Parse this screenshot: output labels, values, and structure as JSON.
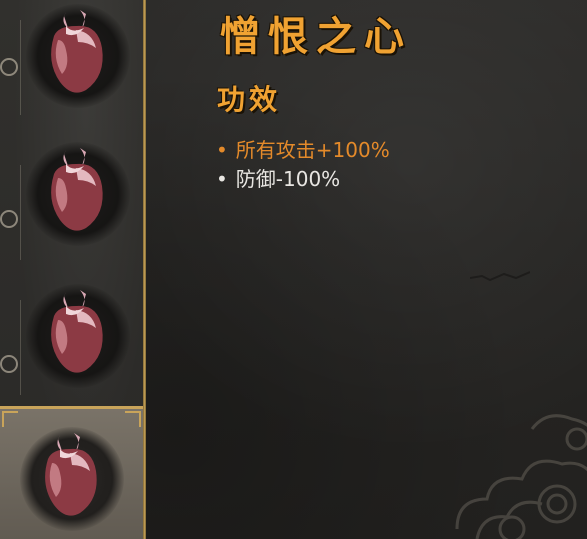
{
  "item": {
    "name": "憎恨之心",
    "section_heading": "功效",
    "effects": [
      {
        "bullet": "•",
        "text": "所有攻击+100%"
      },
      {
        "bullet": "•",
        "text": "防御-100%"
      }
    ]
  },
  "slots": [
    {
      "icon": "heart-icon",
      "selected": false
    },
    {
      "icon": "heart-icon",
      "selected": false
    },
    {
      "icon": "heart-icon",
      "selected": false
    },
    {
      "icon": "heart-icon",
      "selected": true
    }
  ],
  "colors": {
    "title": "#f0a232",
    "positive_effect": "#e48a2a",
    "negative_effect": "#e8e6e2",
    "frame_gold": "#c9a45a"
  }
}
